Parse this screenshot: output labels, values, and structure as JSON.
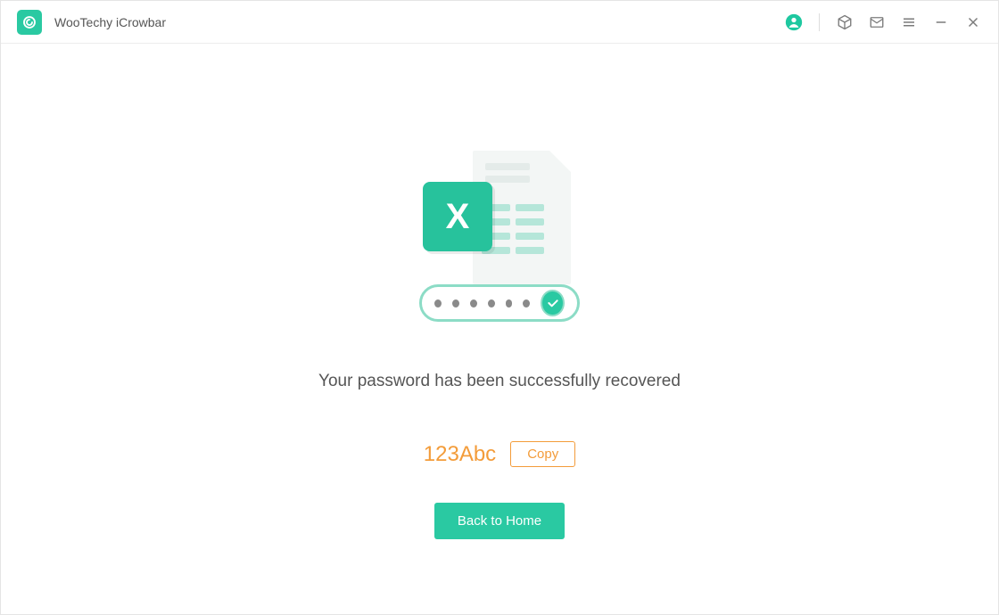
{
  "app": {
    "title": "WooTechy iCrowbar"
  },
  "main": {
    "success_message": "Your password has been successfully recovered",
    "recovered_password": "123Abc",
    "copy_label": "Copy",
    "home_label": "Back to Home"
  },
  "colors": {
    "accent": "#2ac9a2",
    "password": "#f39c3a"
  }
}
